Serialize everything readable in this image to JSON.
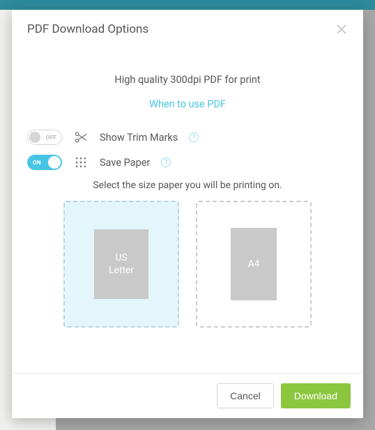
{
  "header": {
    "title": "PDF Download Options"
  },
  "subtitle": "High quality 300dpi PDF for print",
  "link": "When to use PDF",
  "options": {
    "trim": {
      "label": "Show Trim Marks",
      "state": "OFF"
    },
    "save_paper": {
      "label": "Save Paper",
      "state": "ON"
    }
  },
  "paper": {
    "prompt": "Select the size paper you will be printing on.",
    "choices": {
      "letter": {
        "label": "US\nLetter",
        "selected": true
      },
      "a4": {
        "label": "A4",
        "selected": false
      }
    }
  },
  "footer": {
    "cancel": "Cancel",
    "download": "Download"
  }
}
